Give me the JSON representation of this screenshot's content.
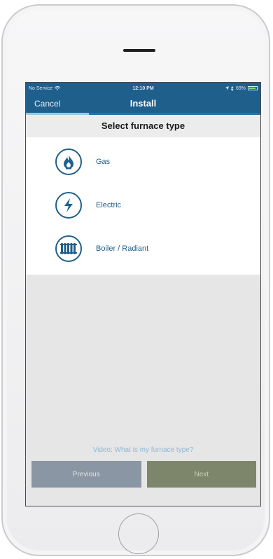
{
  "status_bar": {
    "carrier": "No Service",
    "time": "12:10 PM",
    "battery_text": "69%"
  },
  "nav": {
    "cancel_label": "Cancel",
    "title": "Install",
    "progress_fraction": 0.27
  },
  "heading": "Select furnace type",
  "options": [
    {
      "label": "Gas",
      "icon": "flame-icon"
    },
    {
      "label": "Electric",
      "icon": "lightning-icon"
    },
    {
      "label": "Boiler / Radiant",
      "icon": "radiator-icon"
    }
  ],
  "video_link": "Video: What is my furnace type?",
  "buttons": {
    "previous": "Previous",
    "next": "Next"
  },
  "colors": {
    "brand_blue": "#1f5f8c",
    "next_button": "#7d866a",
    "previous_button": "#8a96a3"
  }
}
